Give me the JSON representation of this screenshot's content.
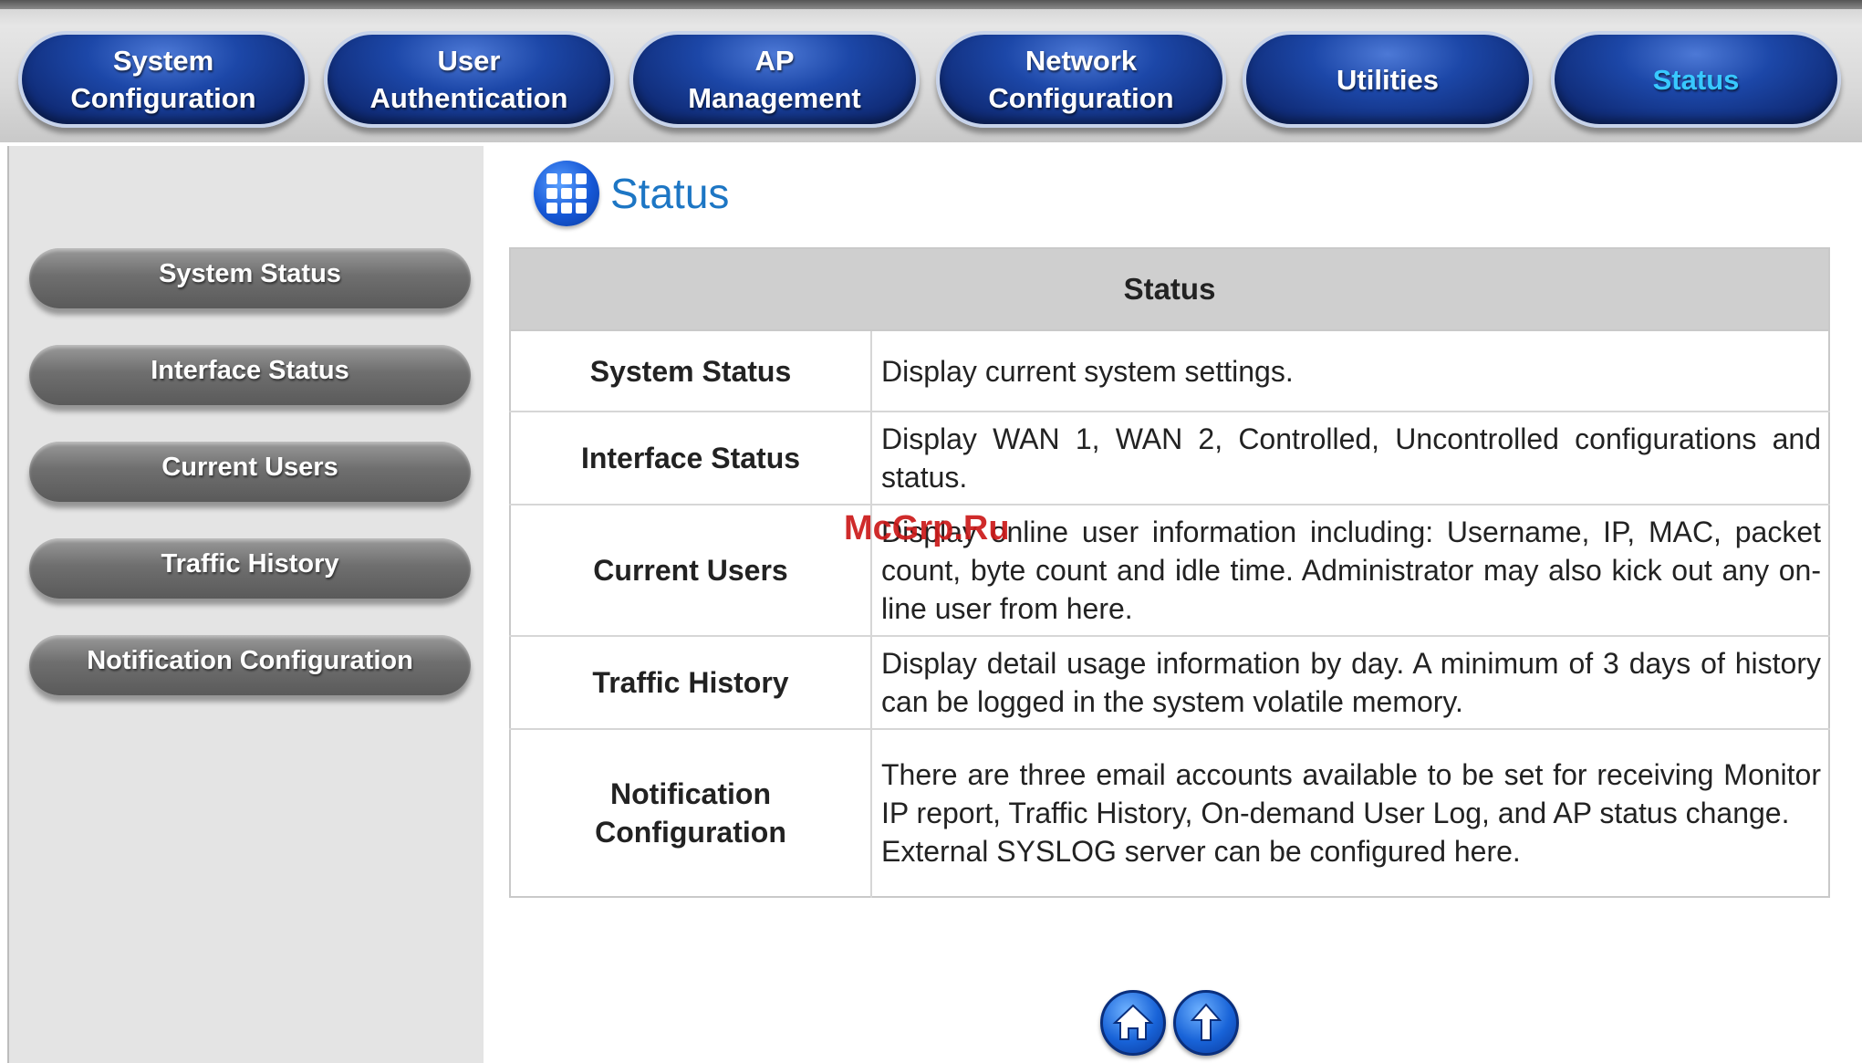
{
  "nav": {
    "items": [
      {
        "label": "System\nConfiguration"
      },
      {
        "label": "User\nAuthentication"
      },
      {
        "label": "AP\nManagement"
      },
      {
        "label": "Network\nConfiguration"
      },
      {
        "label": "Utilities"
      },
      {
        "label": "Status",
        "active": true
      }
    ],
    "active_color": "#38c8ff"
  },
  "sidebar": {
    "items": [
      {
        "label": "System Status"
      },
      {
        "label": "Interface Status"
      },
      {
        "label": "Current Users"
      },
      {
        "label": "Traffic History"
      },
      {
        "label": "Notification Configuration"
      }
    ]
  },
  "main": {
    "title": "Status",
    "icon": "grid-icon",
    "table": {
      "header": "Status",
      "rows": [
        {
          "item": "System Status",
          "desc": "Display current system settings."
        },
        {
          "item": "Interface Status",
          "desc": "Display WAN 1, WAN 2, Controlled, Uncontrolled configurations and status."
        },
        {
          "item": "Current Users",
          "desc": "Display online user information including: Username, IP, MAC, packet count, byte count and idle time. Administrator may also kick out any on-line user from here."
        },
        {
          "item": "Traffic History",
          "desc": "Display detail usage information by day. A minimum of 3 days of history can be logged in the system volatile memory."
        },
        {
          "item": "Notification Configuration",
          "desc": "There are three email accounts available to be set for receiving Monitor IP report, Traffic History, On-demand User Log, and AP status change.\nExternal SYSLOG server can be configured here."
        }
      ]
    }
  },
  "watermark": "McGrp.Ru",
  "footer": {
    "buttons": [
      {
        "icon": "home-icon"
      },
      {
        "icon": "up-arrow-icon"
      }
    ]
  }
}
